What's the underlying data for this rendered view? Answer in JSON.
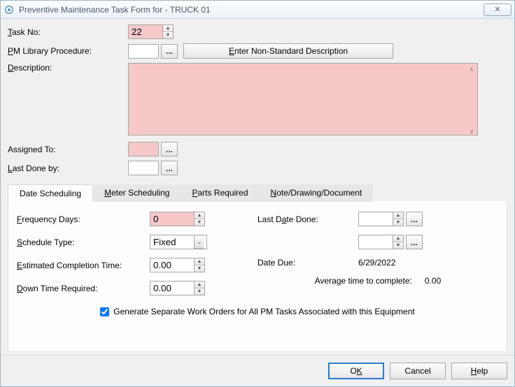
{
  "window": {
    "title": "Preventive Maintenance Task Form for - TRUCK 01",
    "close_glyph": "✕"
  },
  "labels": {
    "task_no": "Task No:",
    "pm_library": "PM Library Procedure:",
    "description": "Description:",
    "assigned_to": "Assigned To:",
    "last_done_by": "Last Done by:",
    "enter_nonstd": "Enter Non-Standard Description",
    "browse": "..."
  },
  "underline_chars": {
    "task_no": "T",
    "pm_library": "P",
    "description": "D",
    "last_done_by": "L",
    "enter_nonstd": "E",
    "meter": "M",
    "parts": "P",
    "note": "N",
    "freq": "F",
    "sched": "S",
    "est": "E",
    "down": "D",
    "last_date": "a",
    "ok": "K",
    "help": "H"
  },
  "fields": {
    "task_no": "22",
    "pm_library": "",
    "description": "",
    "assigned_to": "",
    "last_done_by": ""
  },
  "tabs": {
    "date": "Date Scheduling",
    "meter": "Meter Scheduling",
    "parts": "Parts Required",
    "note": "Note/Drawing/Document"
  },
  "sched": {
    "freq_days_label": "Frequency Days:",
    "freq_days": "0",
    "schedule_type_label": "Schedule Type:",
    "schedule_type": "Fixed",
    "est_completion_label": "Estimated Completion Time:",
    "est_completion": "0.00",
    "down_time_label": "Down Time Required:",
    "down_time": "0.00",
    "last_date_done_label": "Last Date Done:",
    "last_date_done": "",
    "aux_date": "",
    "date_due_label": "Date Due:",
    "date_due": "6/29/2022",
    "avg_label": "Average time to complete:",
    "avg_value": "0.00",
    "checkbox_label": "Generate Separate Work Orders for All PM Tasks Associated with this Equipment",
    "checkbox_checked": true
  },
  "footer": {
    "ok": "OK",
    "cancel": "Cancel",
    "help": "Help"
  }
}
